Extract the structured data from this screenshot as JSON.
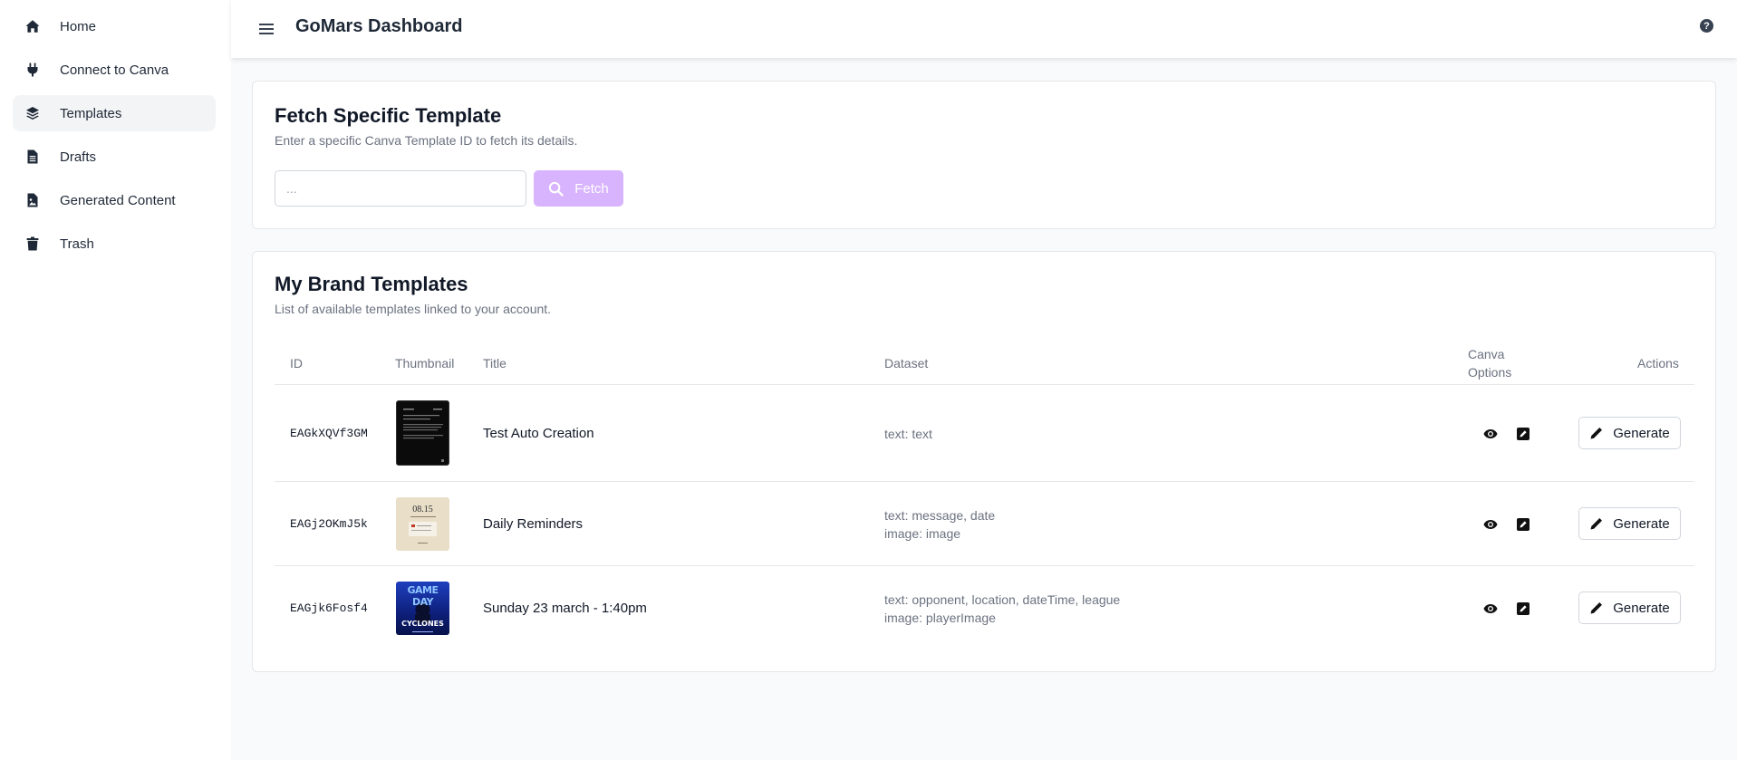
{
  "sidebar": {
    "items": [
      {
        "label": "Home",
        "icon": "home-icon",
        "active": false
      },
      {
        "label": "Connect to Canva",
        "icon": "plug-icon",
        "active": false
      },
      {
        "label": "Templates",
        "icon": "layers-icon",
        "active": true
      },
      {
        "label": "Drafts",
        "icon": "file-icon",
        "active": false
      },
      {
        "label": "Generated Content",
        "icon": "file-image-icon",
        "active": false
      },
      {
        "label": "Trash",
        "icon": "trash-icon",
        "active": false
      }
    ]
  },
  "header": {
    "title": "GoMars Dashboard",
    "help_label": "?"
  },
  "fetch_card": {
    "title": "Fetch Specific Template",
    "subtitle": "Enter a specific Canva Template ID to fetch its details.",
    "input_placeholder": "...",
    "button_label": "Fetch"
  },
  "templates_card": {
    "title": "My Brand Templates",
    "subtitle": "List of available templates linked to your account.",
    "columns": {
      "id": "ID",
      "thumbnail": "Thumbnail",
      "title": "Title",
      "dataset": "Dataset",
      "canva_options_1": "Canva",
      "canva_options_2": "Options",
      "actions": "Actions"
    },
    "rows": [
      {
        "id": "EAGkXQVf3GM",
        "title": "Test Auto Creation",
        "dataset": [
          "text: text"
        ],
        "action": "Generate"
      },
      {
        "id": "EAGj2OKmJ5k",
        "title": "Daily Reminders",
        "dataset": [
          "text: message, date",
          "image: image"
        ],
        "thumb_text": "08.15",
        "action": "Generate"
      },
      {
        "id": "EAGjk6Fosf4",
        "title": "Sunday 23 march - 1:40pm",
        "dataset": [
          "text: opponent, location, dateTime, league",
          "image: playerImage"
        ],
        "thumb_text_1": "GAME DAY",
        "thumb_text_2": "CYCLONES",
        "action": "Generate"
      }
    ]
  },
  "colors": {
    "accent_disabled": "#d8b4fe",
    "sidebar_active": "#f3f4f6",
    "text_muted": "#6b7280"
  }
}
